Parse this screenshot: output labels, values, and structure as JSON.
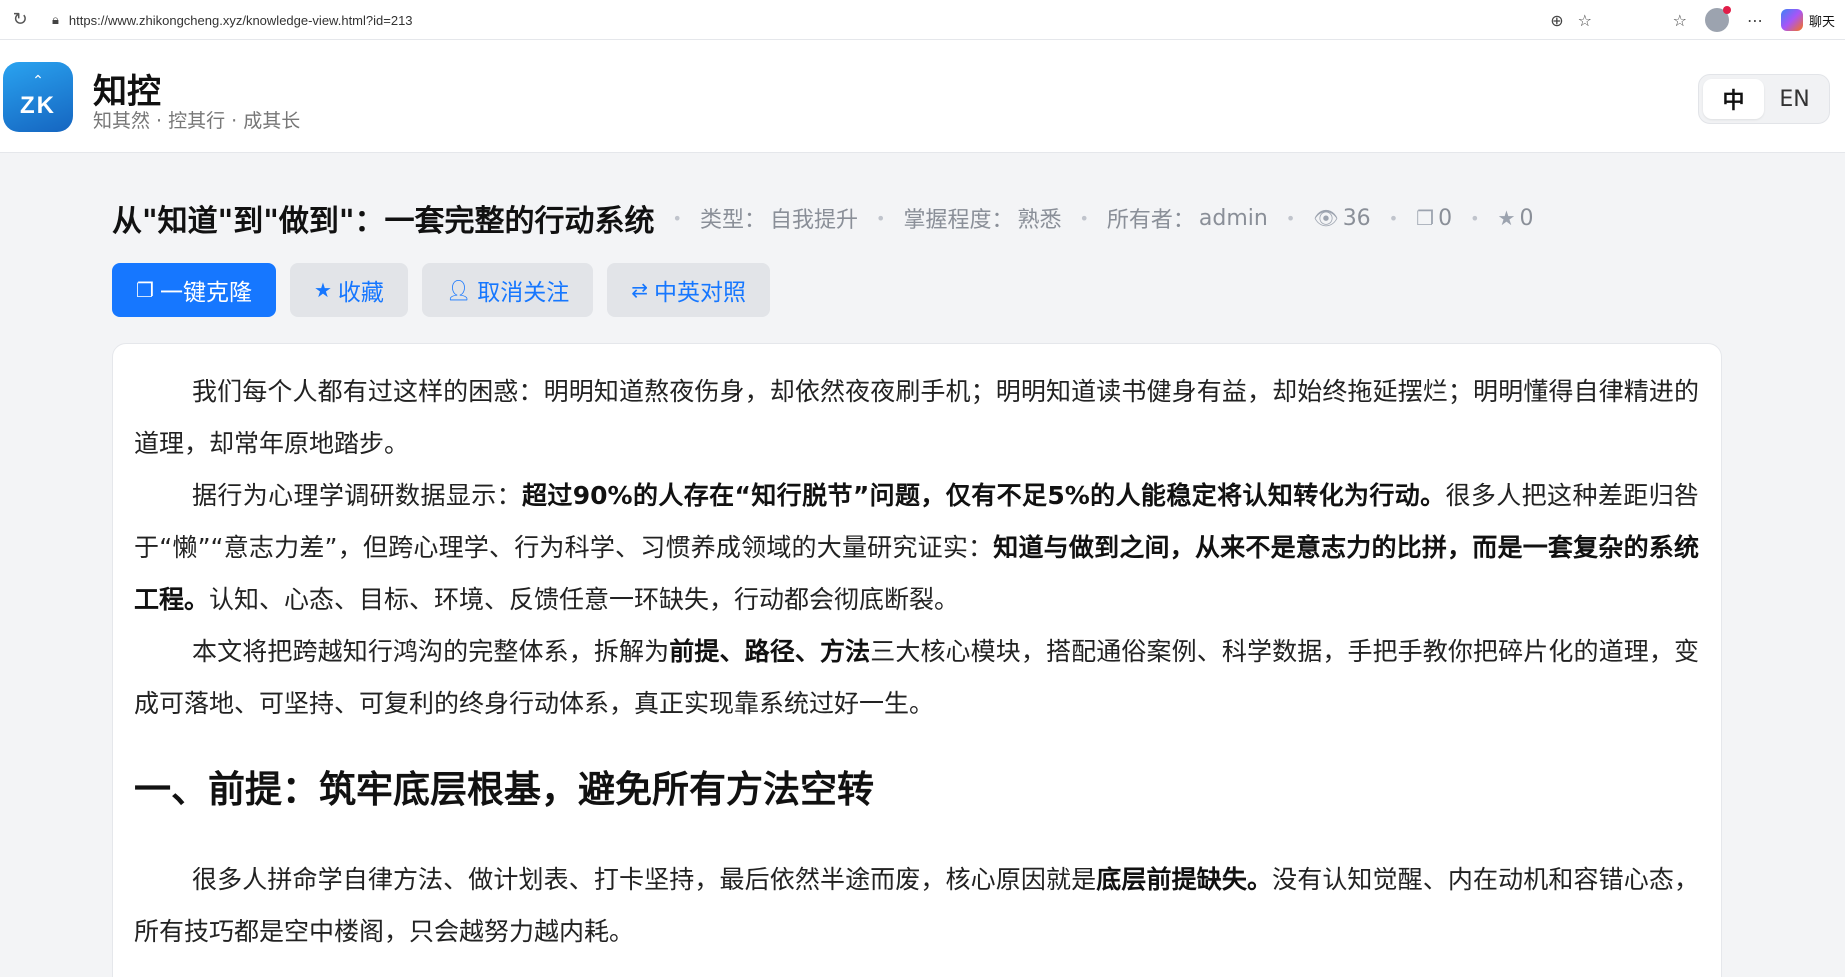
{
  "browser": {
    "url": "https://www.zhikongcheng.xyz/knowledge-view.html?id=213",
    "copilot_label": "聊天"
  },
  "site": {
    "logo_text": "ZK",
    "brand_name": "知控",
    "slogan": "知其然 · 控其行 · 成其长",
    "lang": [
      "中",
      "EN"
    ]
  },
  "doc": {
    "title": "从\"知道\"到\"做到\"：一套完整的行动系统",
    "type_label": "类型：",
    "type_value": "自我提升",
    "mastery_label": "掌握程度：",
    "mastery_value": "熟悉",
    "owner_label": "所有者：",
    "owner_value": "admin",
    "views": "36",
    "clones": "0",
    "favorites": "0"
  },
  "actions": {
    "clone": "一键克隆",
    "favorite": "收藏",
    "unfollow": "取消关注",
    "bilingual": "中英对照"
  },
  "content": {
    "p1": "我们每个人都有过这样的困惑：明明知道熬夜伤身，却依然夜夜刷手机；明明知道读书健身有益，却始终拖延摆烂；明明懂得自律精进的道理，却常年原地踏步。",
    "p2_a": "据行为心理学调研数据显示：",
    "p2_b": "超过90%的人存在“知行脱节”问题，仅有不足5%的人能稳定将认知转化为行动。",
    "p2_c": "很多人把这种差距归咎于“懒”“意志力差”，但跨心理学、行为科学、习惯养成领域的大量研究证实：",
    "p2_d": "知道与做到之间，从来不是意志力的比拼，而是一套复杂的系统工程。",
    "p2_e": "认知、心态、目标、环境、反馈任意一环缺失，行动都会彻底断裂。",
    "p3_a": "本文将把跨越知行鸿沟的完整体系，拆解为",
    "p3_b": "前提、路径、方法",
    "p3_c": "三大核心模块，搭配通俗案例、科学数据，手把手教你把碎片化的道理，变成可落地、可坚持、可复利的终身行动体系，真正实现靠系统过好一生。",
    "h1": "一、前提：筑牢底层根基，避免所有方法空转",
    "p4_a": "很多人拼命学自律方法、做计划表、打卡坚持，最后依然半途而废，核心原因就是",
    "p4_b": "底层前提缺失。",
    "p4_c": "没有认知觉醒、内在动机和容错心态，所有技巧都是空中楼阁，只会越努力越内耗。"
  }
}
